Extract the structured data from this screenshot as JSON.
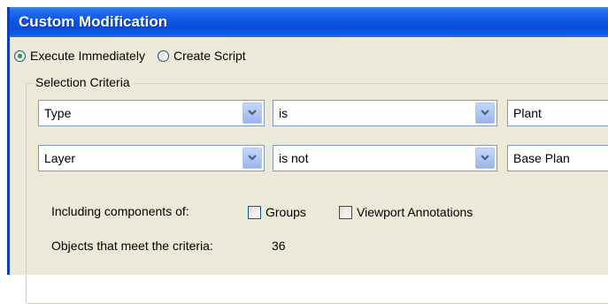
{
  "window": {
    "title": "Custom Modification"
  },
  "mode": {
    "options": [
      {
        "label": "Execute Immediately",
        "selected": true
      },
      {
        "label": "Create Script",
        "selected": false
      }
    ]
  },
  "criteria": {
    "legend": "Selection Criteria",
    "rows": [
      {
        "field": "Type",
        "operator": "is",
        "value": "Plant"
      },
      {
        "field": "Layer",
        "operator": "is not",
        "value": "Base Plan"
      }
    ]
  },
  "including": {
    "label": "Including components of:",
    "options": [
      {
        "label": "Groups",
        "checked": false
      },
      {
        "label": "Viewport Annotations",
        "checked": false
      }
    ]
  },
  "result": {
    "label": "Objects that meet the criteria:",
    "count": "36"
  },
  "icons": {
    "dropdown": "chevron-down-icon"
  }
}
